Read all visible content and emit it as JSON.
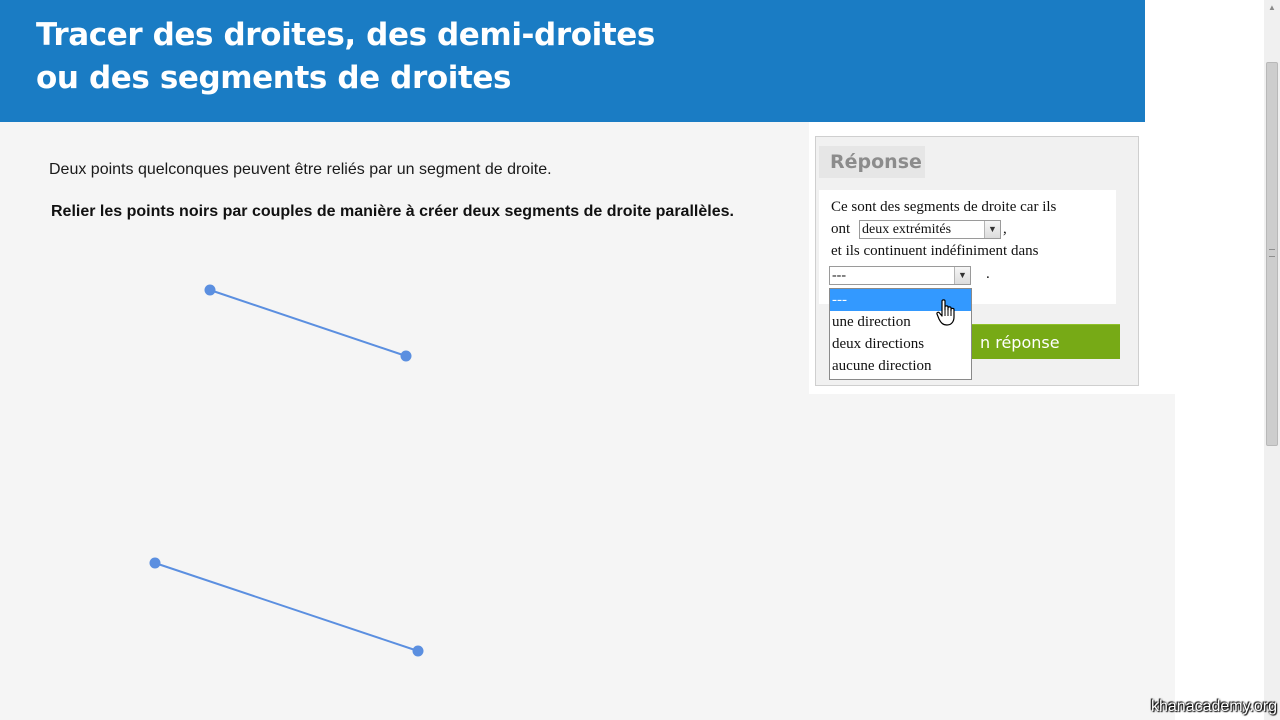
{
  "header": {
    "title_line1": "Tracer des droites, des demi-droites",
    "title_line2": "ou des segments de droites"
  },
  "exercise": {
    "intro": "Deux points quelconques peuvent être reliés par un segment de droite.",
    "instruction": "Relier les points noirs par couples de manière à créer deux segments de droite parallèles."
  },
  "answer_panel": {
    "heading": "Réponse",
    "line1": "Ce sont des segments de droite car ils",
    "line2_prefix": "ont",
    "select1_value": "deux extrémités",
    "line2_suffix": ",",
    "line3": "et ils continuent indéfiniment dans",
    "select2_value": "---",
    "line4_suffix": ".",
    "check_button_visible_label": "n réponse",
    "dropdown_options": [
      "---",
      "une direction",
      "deux directions",
      "aucune direction"
    ],
    "dropdown_selected_index": 0
  },
  "colors": {
    "banner": "#1a7cc4",
    "segment": "#5b8fe0",
    "check_button": "#77aa16",
    "option_highlight": "#3399ff"
  },
  "watermark": "khanacademy.org"
}
